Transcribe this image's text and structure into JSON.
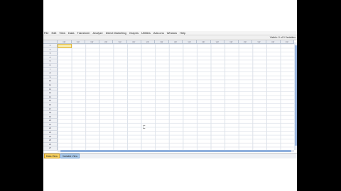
{
  "menubar": {
    "items": [
      {
        "label": "File"
      },
      {
        "label": "Edit"
      },
      {
        "label": "View"
      },
      {
        "label": "Data"
      },
      {
        "label": "Transform"
      },
      {
        "label": "Analyze"
      },
      {
        "label": "Direct Marketing"
      },
      {
        "label": "Graphs"
      },
      {
        "label": "Utilities"
      },
      {
        "label": "Add-ons"
      },
      {
        "label": "Window"
      },
      {
        "label": "Help"
      }
    ]
  },
  "toolbar": {
    "visible_info": "Visible: 0 of 0 Variables"
  },
  "grid": {
    "columns": [
      "var",
      "var",
      "var",
      "var",
      "var",
      "var",
      "var",
      "var",
      "var",
      "var",
      "var",
      "var",
      "var",
      "var",
      "var",
      "var",
      "var"
    ],
    "rows": [
      "1",
      "2",
      "3",
      "4",
      "5",
      "6",
      "7",
      "8",
      "9",
      "10",
      "11",
      "12",
      "13",
      "14",
      "15",
      "16",
      "17",
      "18",
      "19",
      "20",
      "21",
      "22",
      "23",
      "24",
      "25",
      "26",
      "27"
    ]
  },
  "tabs": [
    {
      "label": "Data View",
      "active": true
    },
    {
      "label": "Variable View",
      "active": false
    }
  ],
  "colors": {
    "active_tab": "#f6d060",
    "inactive_tab": "#a9c8e8",
    "active_cell": "#f8ecb0"
  },
  "icons": {
    "cursor": "mouse-cursor-icon"
  }
}
